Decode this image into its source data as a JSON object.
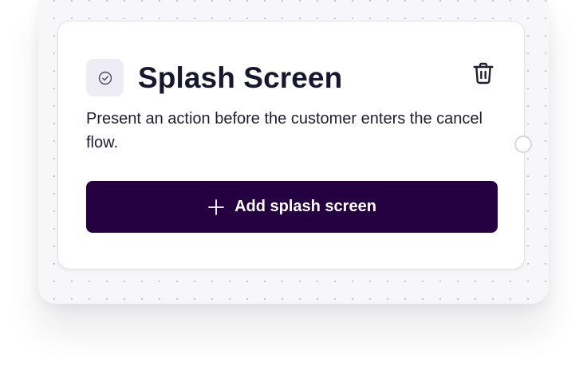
{
  "card": {
    "icon": "check-circle-icon",
    "title": "Splash Screen",
    "description": "Present an action before the customer enters the cancel flow.",
    "delete_icon": "trash-icon"
  },
  "add_button": {
    "icon": "plus-icon",
    "label": "Add splash screen"
  },
  "colors": {
    "button_bg": "#250040",
    "title_text": "#17172e",
    "badge_bg": "#eeedf5",
    "canvas_bg": "#f7f7f9"
  }
}
